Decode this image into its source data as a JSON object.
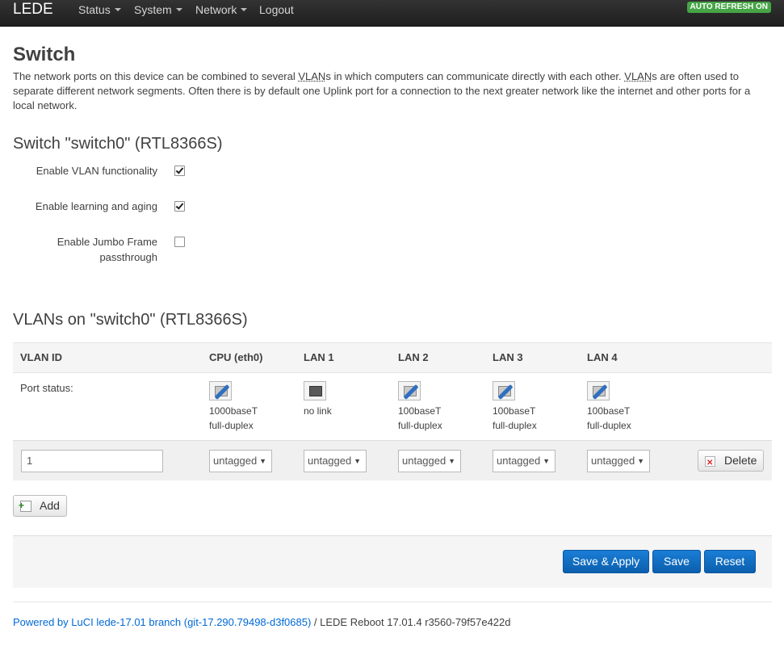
{
  "navbar": {
    "brand": "LEDE",
    "items": [
      {
        "label": "Status",
        "dropdown": true
      },
      {
        "label": "System",
        "dropdown": true
      },
      {
        "label": "Network",
        "dropdown": true
      },
      {
        "label": "Logout",
        "dropdown": false
      }
    ],
    "auto_refresh": "AUTO REFRESH ON"
  },
  "page": {
    "title": "Switch",
    "description_parts": [
      "The network ports on this device can be combined to several ",
      "VLAN",
      "s in which computers can communicate directly with each other. ",
      "VLAN",
      "s are often used to separate different network segments. Often there is by default one Uplink port for a connection to the next greater network like the internet and other ports for a local network."
    ]
  },
  "switch_section": {
    "title": "Switch \"switch0\" (RTL8366S)",
    "options": [
      {
        "label": "Enable VLAN functionality",
        "checked": true
      },
      {
        "label": "Enable learning and aging",
        "checked": true
      },
      {
        "label_line1": "Enable Jumbo Frame",
        "label_line2": "passthrough",
        "checked": false
      }
    ]
  },
  "vlan_section": {
    "title": "VLANs on \"switch0\" (RTL8366S)",
    "headers": [
      "VLAN ID",
      "CPU (eth0)",
      "LAN 1",
      "LAN 2",
      "LAN 3",
      "LAN 4"
    ],
    "port_status_label": "Port status:",
    "port_status": [
      {
        "line1": "1000baseT",
        "line2": "full-duplex",
        "link": true
      },
      {
        "line1": "no link",
        "line2": "",
        "link": false
      },
      {
        "line1": "100baseT",
        "line2": "full-duplex",
        "link": true
      },
      {
        "line1": "100baseT",
        "line2": "full-duplex",
        "link": true
      },
      {
        "line1": "100baseT",
        "line2": "full-duplex",
        "link": true
      }
    ],
    "rows": [
      {
        "vlan_id": "1",
        "ports": [
          "untagged",
          "untagged",
          "untagged",
          "untagged",
          "untagged"
        ]
      }
    ],
    "delete_label": "Delete",
    "add_label": "Add"
  },
  "actions": {
    "save_apply": "Save & Apply",
    "save": "Save",
    "reset": "Reset"
  },
  "footer": {
    "link_text": "Powered by LuCI lede-17.01 branch (git-17.290.79498-d3f0685)",
    "rest_text": " / LEDE Reboot 17.01.4 r3560-79f57e422d"
  },
  "colors": {
    "primary": "#0b5fad",
    "auto_refresh_bg": "#46a546",
    "link": "#0069d6"
  }
}
